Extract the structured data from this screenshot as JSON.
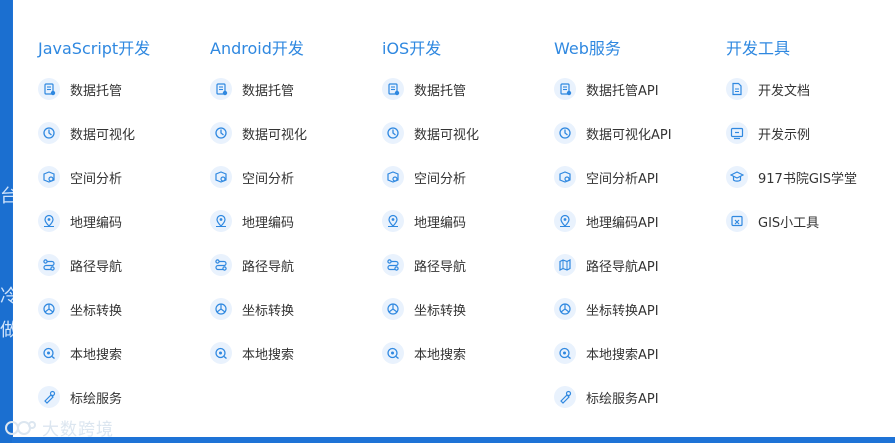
{
  "background": {
    "marks": [
      "台",
      "冷",
      "做"
    ]
  },
  "columns": [
    {
      "title": "JavaScript开发",
      "items": [
        {
          "label": "数据托管",
          "icon": "data-hosting-icon"
        },
        {
          "label": "数据可视化",
          "icon": "visualization-icon"
        },
        {
          "label": "空间分析",
          "icon": "spatial-analysis-icon"
        },
        {
          "label": "地理编码",
          "icon": "geocoding-icon"
        },
        {
          "label": "路径导航",
          "icon": "route-icon"
        },
        {
          "label": "坐标转换",
          "icon": "coordinate-icon"
        },
        {
          "label": "本地搜索",
          "icon": "search-icon"
        },
        {
          "label": "标绘服务",
          "icon": "plotting-icon"
        }
      ]
    },
    {
      "title": "Android开发",
      "items": [
        {
          "label": "数据托管",
          "icon": "data-hosting-icon"
        },
        {
          "label": "数据可视化",
          "icon": "visualization-icon"
        },
        {
          "label": "空间分析",
          "icon": "spatial-analysis-icon"
        },
        {
          "label": "地理编码",
          "icon": "geocoding-icon"
        },
        {
          "label": "路径导航",
          "icon": "route-icon"
        },
        {
          "label": "坐标转换",
          "icon": "coordinate-icon"
        },
        {
          "label": "本地搜索",
          "icon": "search-icon"
        }
      ]
    },
    {
      "title": "iOS开发",
      "items": [
        {
          "label": "数据托管",
          "icon": "data-hosting-icon"
        },
        {
          "label": "数据可视化",
          "icon": "visualization-icon"
        },
        {
          "label": "空间分析",
          "icon": "spatial-analysis-icon"
        },
        {
          "label": "地理编码",
          "icon": "geocoding-icon"
        },
        {
          "label": "路径导航",
          "icon": "route-icon"
        },
        {
          "label": "坐标转换",
          "icon": "coordinate-icon"
        },
        {
          "label": "本地搜索",
          "icon": "search-icon"
        }
      ]
    },
    {
      "title": "Web服务",
      "items": [
        {
          "label": "数据托管API",
          "icon": "data-hosting-icon"
        },
        {
          "label": "数据可视化API",
          "icon": "visualization-icon"
        },
        {
          "label": "空间分析API",
          "icon": "spatial-analysis-icon"
        },
        {
          "label": "地理编码API",
          "icon": "geocoding-icon"
        },
        {
          "label": "路径导航API",
          "icon": "map-icon"
        },
        {
          "label": "坐标转换API",
          "icon": "coordinate-icon"
        },
        {
          "label": "本地搜索API",
          "icon": "search-icon"
        },
        {
          "label": "标绘服务API",
          "icon": "plotting-icon"
        }
      ]
    },
    {
      "title": "开发工具",
      "items": [
        {
          "label": "开发文档",
          "icon": "document-icon"
        },
        {
          "label": "开发示例",
          "icon": "example-icon"
        },
        {
          "label": "917书院GIS学堂",
          "icon": "graduation-cap-icon"
        },
        {
          "label": "GIS小工具",
          "icon": "tool-icon"
        }
      ]
    }
  ],
  "watermark": {
    "text": "大数跨境"
  },
  "colors": {
    "accent": "#2f88e0",
    "text": "#333333",
    "icon_bg": "#e9f2fd",
    "page_bg": "#1e73d6"
  }
}
